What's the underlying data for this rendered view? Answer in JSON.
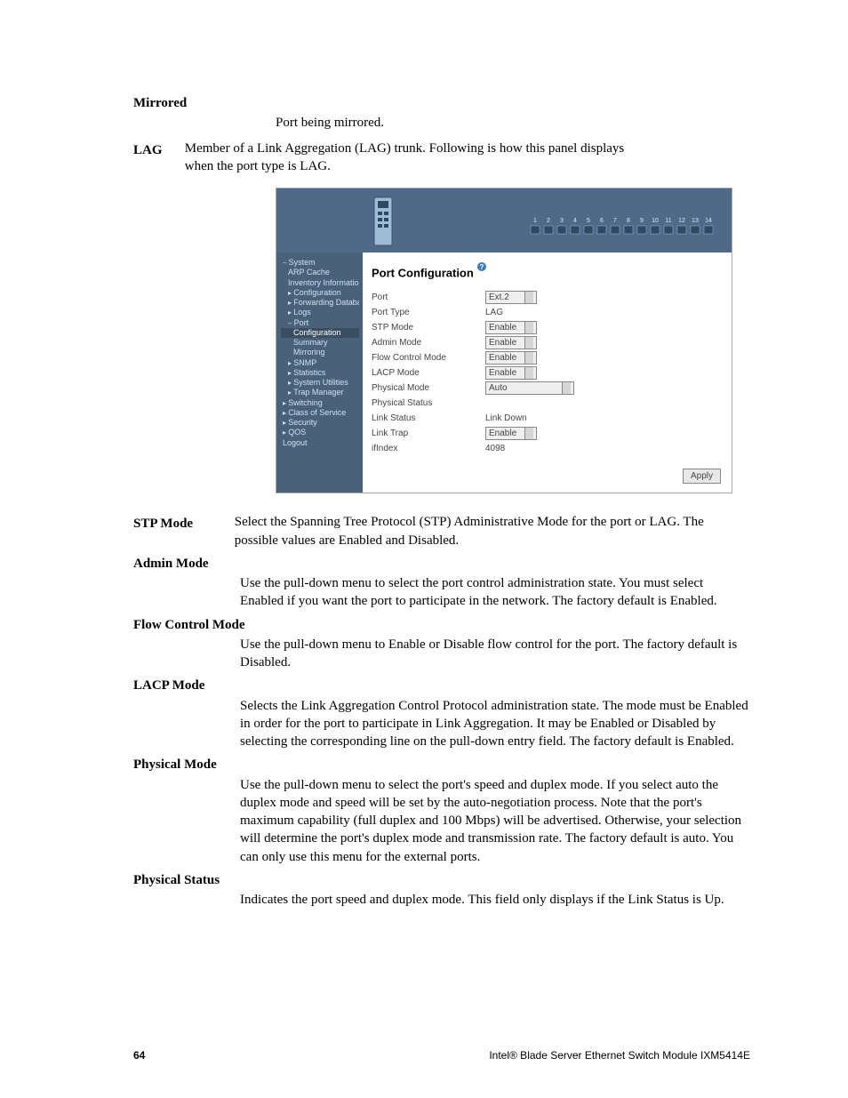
{
  "terms": {
    "mirrored": {
      "label": "Mirrored",
      "desc": "Port being mirrored."
    },
    "lag": {
      "label": "LAG",
      "desc": "Member of a Link Aggregation (LAG) trunk. Following is how this panel displays when the port type is LAG."
    },
    "stp_mode": {
      "label": "STP Mode",
      "desc": "Select the Spanning Tree Protocol (STP) Administrative Mode for the port or LAG. The possible values are Enabled and Disabled."
    },
    "admin_mode": {
      "label": "Admin Mode",
      "desc": "Use the pull-down menu to select the port control administration state. You must select Enabled if you want the port to participate in the network. The factory default is Enabled."
    },
    "flow_control_mode": {
      "label": "Flow Control Mode",
      "desc": "Use the pull-down menu to Enable or Disable flow control for the port. The factory default is Disabled."
    },
    "lacp_mode": {
      "label": "LACP Mode",
      "desc": "Selects the Link Aggregation Control Protocol administration state. The mode must be Enabled in order for the port to participate in Link Aggregation. It may be Enabled or Disabled by selecting the corresponding line on the pull-down entry field. The factory default is Enabled."
    },
    "physical_mode": {
      "label": "Physical Mode",
      "desc": "Use the pull-down menu to select the port's speed and duplex mode. If you select auto the duplex mode and speed will be set by the auto-negotiation process. Note that the port's maximum capability (full duplex and 100 Mbps) will be advertised. Otherwise, your selection will determine the port's duplex mode and transmission rate. The factory default is auto. You can only use this menu for the external ports."
    },
    "physical_status": {
      "label": "Physical Status",
      "desc": "Indicates the port speed and duplex mode. This field only displays if the Link Status is Up."
    }
  },
  "figure": {
    "title": "Port Configuration",
    "sidebar": [
      {
        "label": "System",
        "lvl": 1,
        "pre": "dash",
        "sel": false
      },
      {
        "label": "ARP Cache",
        "lvl": 2,
        "pre": "",
        "sel": false
      },
      {
        "label": "Inventory Information",
        "lvl": 2,
        "pre": "",
        "sel": false
      },
      {
        "label": "Configuration",
        "lvl": 2,
        "pre": "bullet",
        "sel": false
      },
      {
        "label": "Forwarding Database",
        "lvl": 2,
        "pre": "bullet",
        "sel": false
      },
      {
        "label": "Logs",
        "lvl": 2,
        "pre": "bullet",
        "sel": false
      },
      {
        "label": "Port",
        "lvl": 2,
        "pre": "dash",
        "sel": false
      },
      {
        "label": "Configuration",
        "lvl": 3,
        "pre": "",
        "sel": true
      },
      {
        "label": "Summary",
        "lvl": 3,
        "pre": "",
        "sel": false
      },
      {
        "label": "Mirroring",
        "lvl": 3,
        "pre": "",
        "sel": false
      },
      {
        "label": "SNMP",
        "lvl": 2,
        "pre": "bullet",
        "sel": false
      },
      {
        "label": "Statistics",
        "lvl": 2,
        "pre": "bullet",
        "sel": false
      },
      {
        "label": "System Utilities",
        "lvl": 2,
        "pre": "bullet",
        "sel": false
      },
      {
        "label": "Trap Manager",
        "lvl": 2,
        "pre": "bullet",
        "sel": false
      },
      {
        "label": "Switching",
        "lvl": 1,
        "pre": "bullet",
        "sel": false
      },
      {
        "label": "Class of Service",
        "lvl": 1,
        "pre": "bullet",
        "sel": false
      },
      {
        "label": "Security",
        "lvl": 1,
        "pre": "bullet",
        "sel": false
      },
      {
        "label": "QOS",
        "lvl": 1,
        "pre": "bullet",
        "sel": false
      },
      {
        "label": "Logout",
        "lvl": 1,
        "pre": "",
        "sel": false
      }
    ],
    "fields": {
      "port": {
        "label": "Port",
        "value": "Ext.2",
        "type": "select"
      },
      "port_type": {
        "label": "Port Type",
        "value": "LAG",
        "type": "text"
      },
      "stp_mode": {
        "label": "STP Mode",
        "value": "Enable",
        "type": "select"
      },
      "admin_mode": {
        "label": "Admin Mode",
        "value": "Enable",
        "type": "select"
      },
      "flow_control": {
        "label": "Flow Control Mode",
        "value": "Enable",
        "type": "select"
      },
      "lacp_mode": {
        "label": "LACP Mode",
        "value": "Enable",
        "type": "select"
      },
      "physical_mode": {
        "label": "Physical Mode",
        "value": "Auto",
        "type": "select-lg"
      },
      "physical_status": {
        "label": "Physical Status",
        "value": "",
        "type": "text"
      },
      "link_status": {
        "label": "Link Status",
        "value": "Link Down",
        "type": "text"
      },
      "link_trap": {
        "label": "Link Trap",
        "value": "Enable",
        "type": "select"
      },
      "ifindex": {
        "label": "ifIndex",
        "value": "4098",
        "type": "text"
      }
    },
    "apply_label": "Apply",
    "port_numbers": [
      "1",
      "2",
      "3",
      "4",
      "5",
      "6",
      "7",
      "8",
      "9",
      "10",
      "11",
      "12",
      "13",
      "14"
    ]
  },
  "footer": {
    "page": "64",
    "doc": "Intel® Blade Server Ethernet Switch Module IXM5414E"
  }
}
